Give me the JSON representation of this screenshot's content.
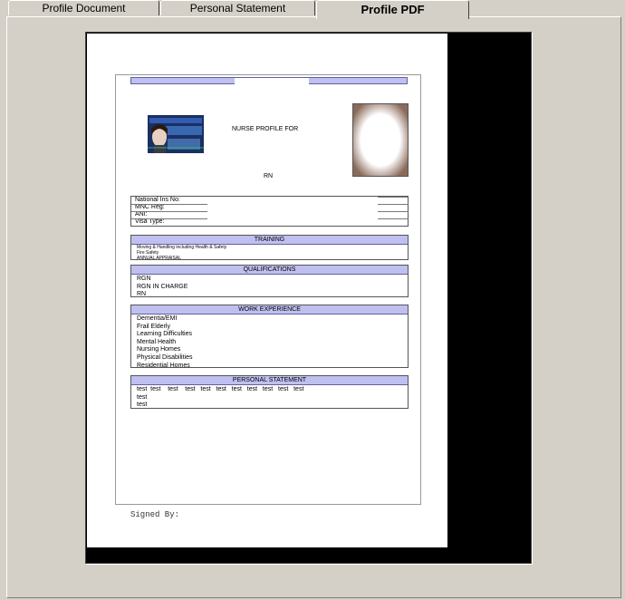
{
  "tabs": [
    {
      "label": "Profile Document"
    },
    {
      "label": "Personal Statement"
    },
    {
      "label": "Profile PDF"
    }
  ],
  "document": {
    "title": "NURSE PROFILE FOR",
    "subtitle": "RN",
    "info_labels": [
      "National Ins No:",
      "MNC Reg:",
      "ANI:",
      "Visa Type:"
    ],
    "sections": {
      "training": {
        "heading": "TRAINING",
        "items": [
          "Moving & Handling including Health & Safety",
          "Fire Safety",
          "ANNUAL APPRAISAL"
        ]
      },
      "qualifications": {
        "heading": "QUALIFICATIONS",
        "items": [
          "RGN",
          "RGN IN CHARGE",
          "RN"
        ]
      },
      "work_experience": {
        "heading": "WORK EXPERIENCE",
        "items": [
          "Dementia/EMI",
          "Frail Elderly",
          "Learning Difficulties",
          "Mental Health",
          "Nursing Homes",
          "Physical Disabilities",
          "Residential Homes"
        ]
      },
      "personal_statement": {
        "heading": "PERSONAL STATEMENT",
        "line1": "test  test    test    test   test   test   test   test   test   test   test",
        "line2": "test",
        "line3": "test"
      }
    },
    "signed_by": "Signed By:"
  },
  "colors": {
    "section_header": "#c0c0f0",
    "window_bg": "#d4d0c8",
    "viewer_bg": "#000000"
  }
}
